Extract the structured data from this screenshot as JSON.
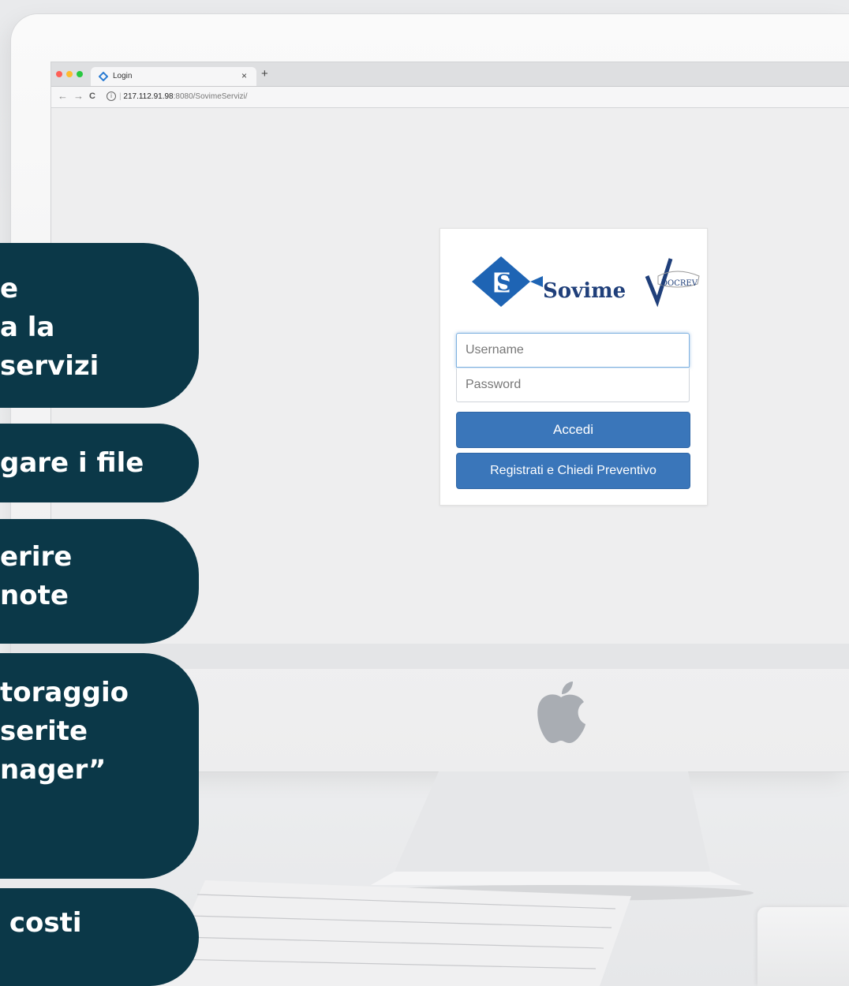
{
  "browser": {
    "tab_title": "Login",
    "tab_close": "×",
    "new_tab": "+",
    "back": "←",
    "forward": "→",
    "reload": "C",
    "url_host": "217.112.91.98",
    "url_rest": ":8080/SovimeServizi/",
    "traffic_colors": [
      "#fe5f57",
      "#febc2e",
      "#28c840"
    ]
  },
  "login": {
    "brand": "Sovime",
    "partner": "DOCREV",
    "username_placeholder": "Username",
    "password_placeholder": "Password",
    "login_button": "Accedi",
    "register_button": "Registrati e Chiedi Preventivo"
  },
  "overlay_pills": [
    {
      "lines": "e\na la\nservizi"
    },
    {
      "lines": "gare i file"
    },
    {
      "lines": "erire\nnote"
    },
    {
      "lines": "toraggio\nserite\nnager”"
    },
    {
      "lines": " costi"
    }
  ],
  "colors": {
    "pill": "#0b3848",
    "button": "#3a76ba",
    "brand_blue": "#1e64b4"
  }
}
